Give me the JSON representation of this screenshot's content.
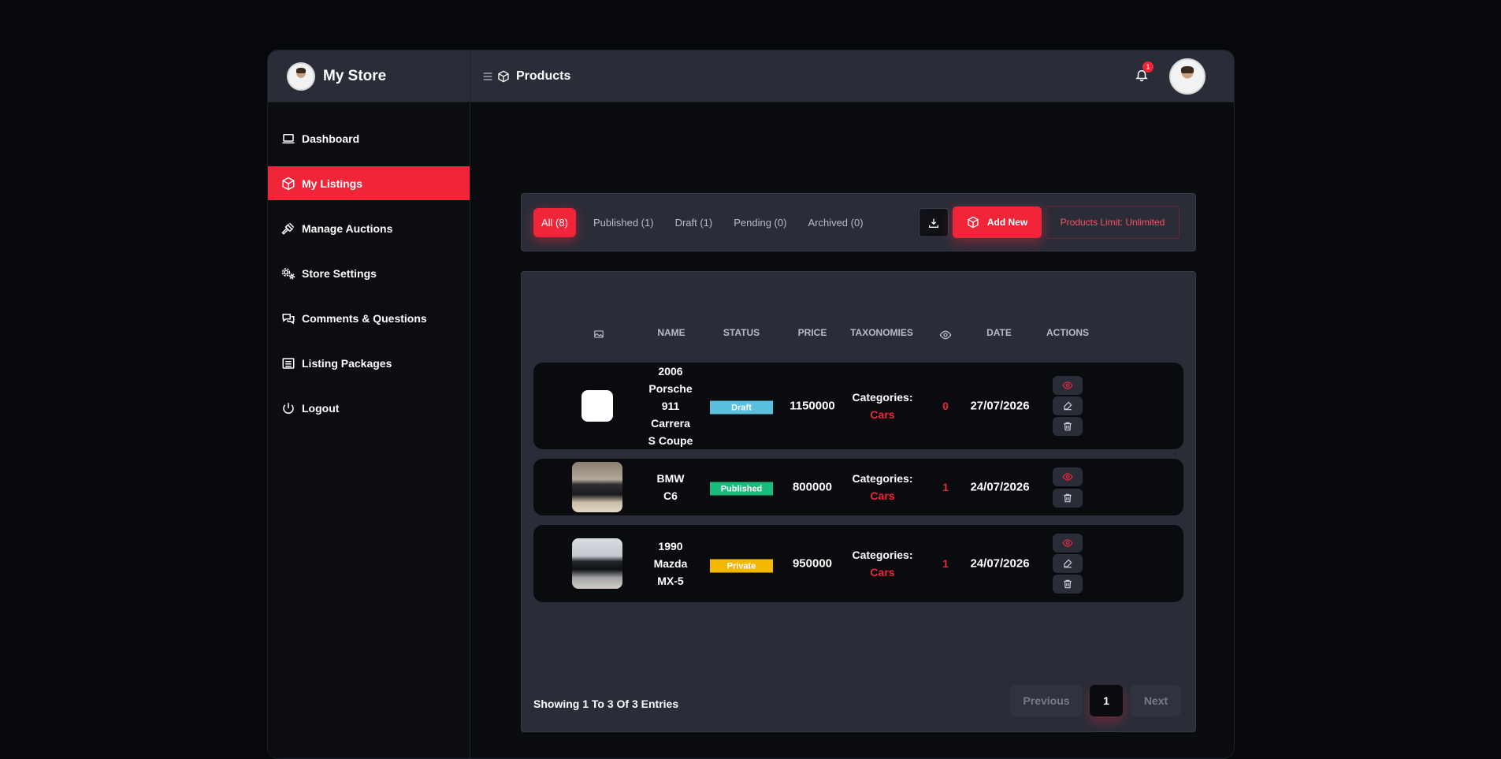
{
  "sidebar": {
    "brand": "My Store",
    "items": [
      {
        "label": "Dashboard",
        "icon": "laptop-icon"
      },
      {
        "label": "My Listings",
        "icon": "box-icon",
        "active": true
      },
      {
        "label": "Manage Auctions",
        "icon": "gavel-icon"
      },
      {
        "label": "Store Settings",
        "icon": "gears-icon"
      },
      {
        "label": "Comments & Questions",
        "icon": "comments-icon"
      },
      {
        "label": "Listing Packages",
        "icon": "list-icon"
      },
      {
        "label": "Logout",
        "icon": "power-icon"
      }
    ]
  },
  "header": {
    "title": "Products",
    "notification_count": "1"
  },
  "filters": {
    "tabs": [
      "All (8)",
      "Published (1)",
      "Draft (1)",
      "Pending (0)",
      "Archived (0)"
    ],
    "add_new": "Add New",
    "limit": "Products Limit: Unlimited"
  },
  "table": {
    "columns": [
      "NAME",
      "STATUS",
      "PRICE",
      "TAXONOMIES",
      "DATE",
      "ACTIONS"
    ],
    "rows": [
      {
        "name": "2006 Porsche 911 Carrera S Coupe",
        "name_lines": [
          "2006",
          "Porsche",
          "911",
          "Carrera",
          "S Coupe"
        ],
        "status": "Draft",
        "status_color": "#5bc0de",
        "price": "1150000",
        "cat_label": "Categories:",
        "cat_value": "Cars",
        "views": "0",
        "date": "27/07/2026"
      },
      {
        "name": "BMW C6",
        "name_lines": [
          "BMW",
          "C6"
        ],
        "status": "Published",
        "status_color": "#1abc7c",
        "price": "800000",
        "cat_label": "Categories:",
        "cat_value": "Cars",
        "views": "1",
        "date": "24/07/2026"
      },
      {
        "name": "1990 Mazda MX-5",
        "name_lines": [
          "1990",
          "Mazda",
          "MX-5"
        ],
        "status": "Private",
        "status_color": "#f5b800",
        "price": "950000",
        "cat_label": "Categories:",
        "cat_value": "Cars",
        "views": "1",
        "date": "24/07/2026"
      }
    ]
  },
  "pagination": {
    "showing": "Showing 1 To 3 Of 3 Entries",
    "previous": "Previous",
    "current": "1",
    "next": "Next"
  },
  "colors": {
    "accent": "#f0253a",
    "panel": "#2a2d38",
    "background": "#0a0c10"
  }
}
